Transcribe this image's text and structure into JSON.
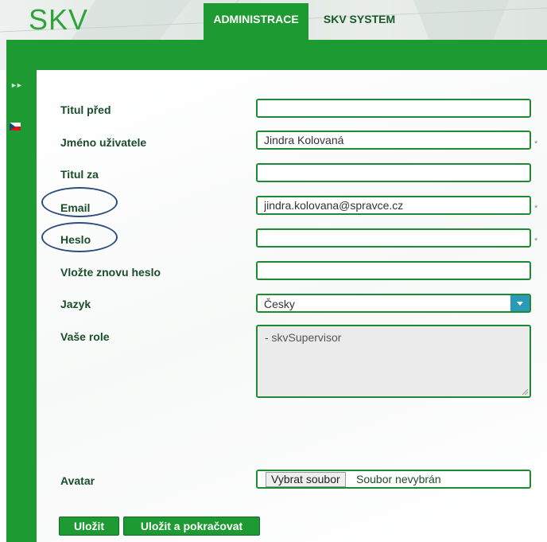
{
  "header": {
    "logo": "SKV",
    "tabs": [
      {
        "label": "ADMINISTRACE",
        "active": true
      },
      {
        "label": "SKV SYSTEM",
        "active": false
      }
    ]
  },
  "sidebar": {
    "expand_icon": "double-chevron-right-icon",
    "language_flag": "czech-flag-icon"
  },
  "form": {
    "fields": [
      {
        "label": "Titul před",
        "value": ""
      },
      {
        "label": "Jméno uživatele",
        "value": "Jindra Kolovaná"
      },
      {
        "label": "Titul za",
        "value": ""
      },
      {
        "label": "Email",
        "value": "jindra.kolovana@spravce.cz"
      },
      {
        "label": "Heslo",
        "value": ""
      },
      {
        "label": "Vložte znovu heslo",
        "value": ""
      }
    ],
    "required_mark": "*",
    "language": {
      "label": "Jazyk",
      "selected": "Česky"
    },
    "roles": {
      "label": "Vaše role",
      "value": "- skvSupervisor"
    },
    "avatar": {
      "label": "Avatar",
      "button": "Vybrat soubor",
      "status": "Soubor nevybrán"
    },
    "buttons": {
      "save": "Uložit",
      "save_continue": "Uložit a pokračovat"
    }
  },
  "colors": {
    "brand_green": "#1e9a32",
    "highlight_oval": "#2f4e7e",
    "select_arrow": "#2a9ab8"
  }
}
